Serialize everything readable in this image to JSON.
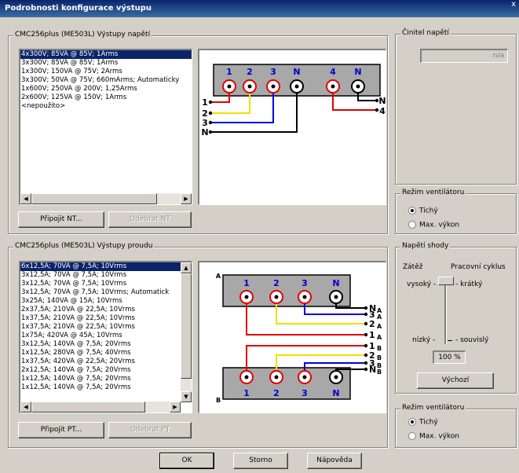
{
  "window": {
    "title": "Podrobnosti konfigurace výstupu",
    "close": "x"
  },
  "voltage": {
    "group_title": "CMC256plus (ME503L) Výstupy napětí",
    "items": [
      "4x300V; 85VA @ 85V; 1Arms",
      "3x300V; 85VA @ 85V; 1Arms",
      "1x300V; 150VA @ 75V; 2Arms",
      "3x300V; 50VA @ 75V; 660mArms; Automaticky",
      "1x600V; 250VA @ 200V; 1,25Arms",
      "2x600V; 125VA @ 150V; 1Arms",
      "<nepoužito>"
    ],
    "selected_index": 0,
    "connect_button": "Připojit NT...",
    "remove_button": "Odebrat NT",
    "diagram": {
      "top_labels": [
        "1",
        "2",
        "3",
        "N",
        "4",
        "N"
      ],
      "side_labels": [
        "1",
        "2",
        "3",
        "N"
      ],
      "right_labels": [
        "N",
        "4"
      ]
    }
  },
  "factor": {
    "group_title": "Činitel napětí",
    "value": "n/a"
  },
  "fan1": {
    "group_title": "Režim ventilátoru",
    "options": [
      "Tichý",
      "Max. výkon"
    ],
    "selected_index": 0
  },
  "current": {
    "group_title": "CMC256plus (ME503L) Výstupy proudu",
    "items": [
      "6x12,5A; 70VA @ 7,5A; 10Vrms",
      "3x12,5A; 70VA @ 7,5A; 10Vrms",
      "3x12,5A; 70VA @ 7,5A; 10Vrms",
      "3x12,5A; 70VA @ 7,5A; 10Vrms; Automatick",
      "3x25A; 140VA @ 15A; 10Vrms",
      "2x37,5A; 210VA @ 22,5A; 10Vrms",
      "1x37,5A; 210VA @ 22,5A; 10Vrms",
      "1x37,5A; 210VA @ 22,5A; 10Vrms",
      "1x75A; 420VA @ 45A; 10Vrms",
      "3x12,5A; 140VA @ 7,5A; 20Vrms",
      "1x12,5A; 280VA @ 7,5A; 40Vrms",
      "1x37,5A; 420VA @ 22,5A; 20Vrms",
      "2x12,5A; 140VA @ 7,5A; 20Vrms",
      "1x12,5A; 140VA @ 7,5A; 20Vrms",
      "1x12,5A; 140VA @ 7,5A; 20Vrms"
    ],
    "selected_index": 0,
    "connect_button": "Připojit PT...",
    "remove_button": "Odebrat PT",
    "diagram": {
      "corner_a": "A",
      "corner_b": "B",
      "top_labels": [
        "1",
        "2",
        "3",
        "N"
      ],
      "bottom_labels": [
        "1",
        "2",
        "3",
        "N"
      ],
      "right_labels": [
        {
          "main": "N",
          "sub": "A"
        },
        {
          "main": "3",
          "sub": "A"
        },
        {
          "main": "2",
          "sub": "A"
        },
        {
          "main": "1",
          "sub": "A"
        },
        {
          "main": "1",
          "sub": "B"
        },
        {
          "main": "2",
          "sub": "B"
        },
        {
          "main": "3",
          "sub": "B"
        },
        {
          "main": "N",
          "sub": "B"
        }
      ]
    }
  },
  "shape": {
    "group_title": "Napětí shody",
    "load_label": "Zátěž",
    "cycle_label": "Pracovní cyklus",
    "high_label": "vysoký -",
    "short_label": "- krátký",
    "low_label": "nízký -",
    "long_label": "- souvislý",
    "value": "100 %",
    "level_percent": 100,
    "default_button": "Výchozí"
  },
  "fan2": {
    "group_title": "Režim ventilátoru",
    "options": [
      "Tichý",
      "Max. výkon"
    ],
    "selected_index": 0
  },
  "footer": {
    "ok": "OK",
    "cancel": "Storno",
    "help": "Nápověda"
  },
  "colors": {
    "red": "#e00000",
    "yellow": "#f0e000",
    "blue": "#0000e0",
    "black": "#000000",
    "label_blue": "#0000cc",
    "title_bar": "#0a246a"
  }
}
